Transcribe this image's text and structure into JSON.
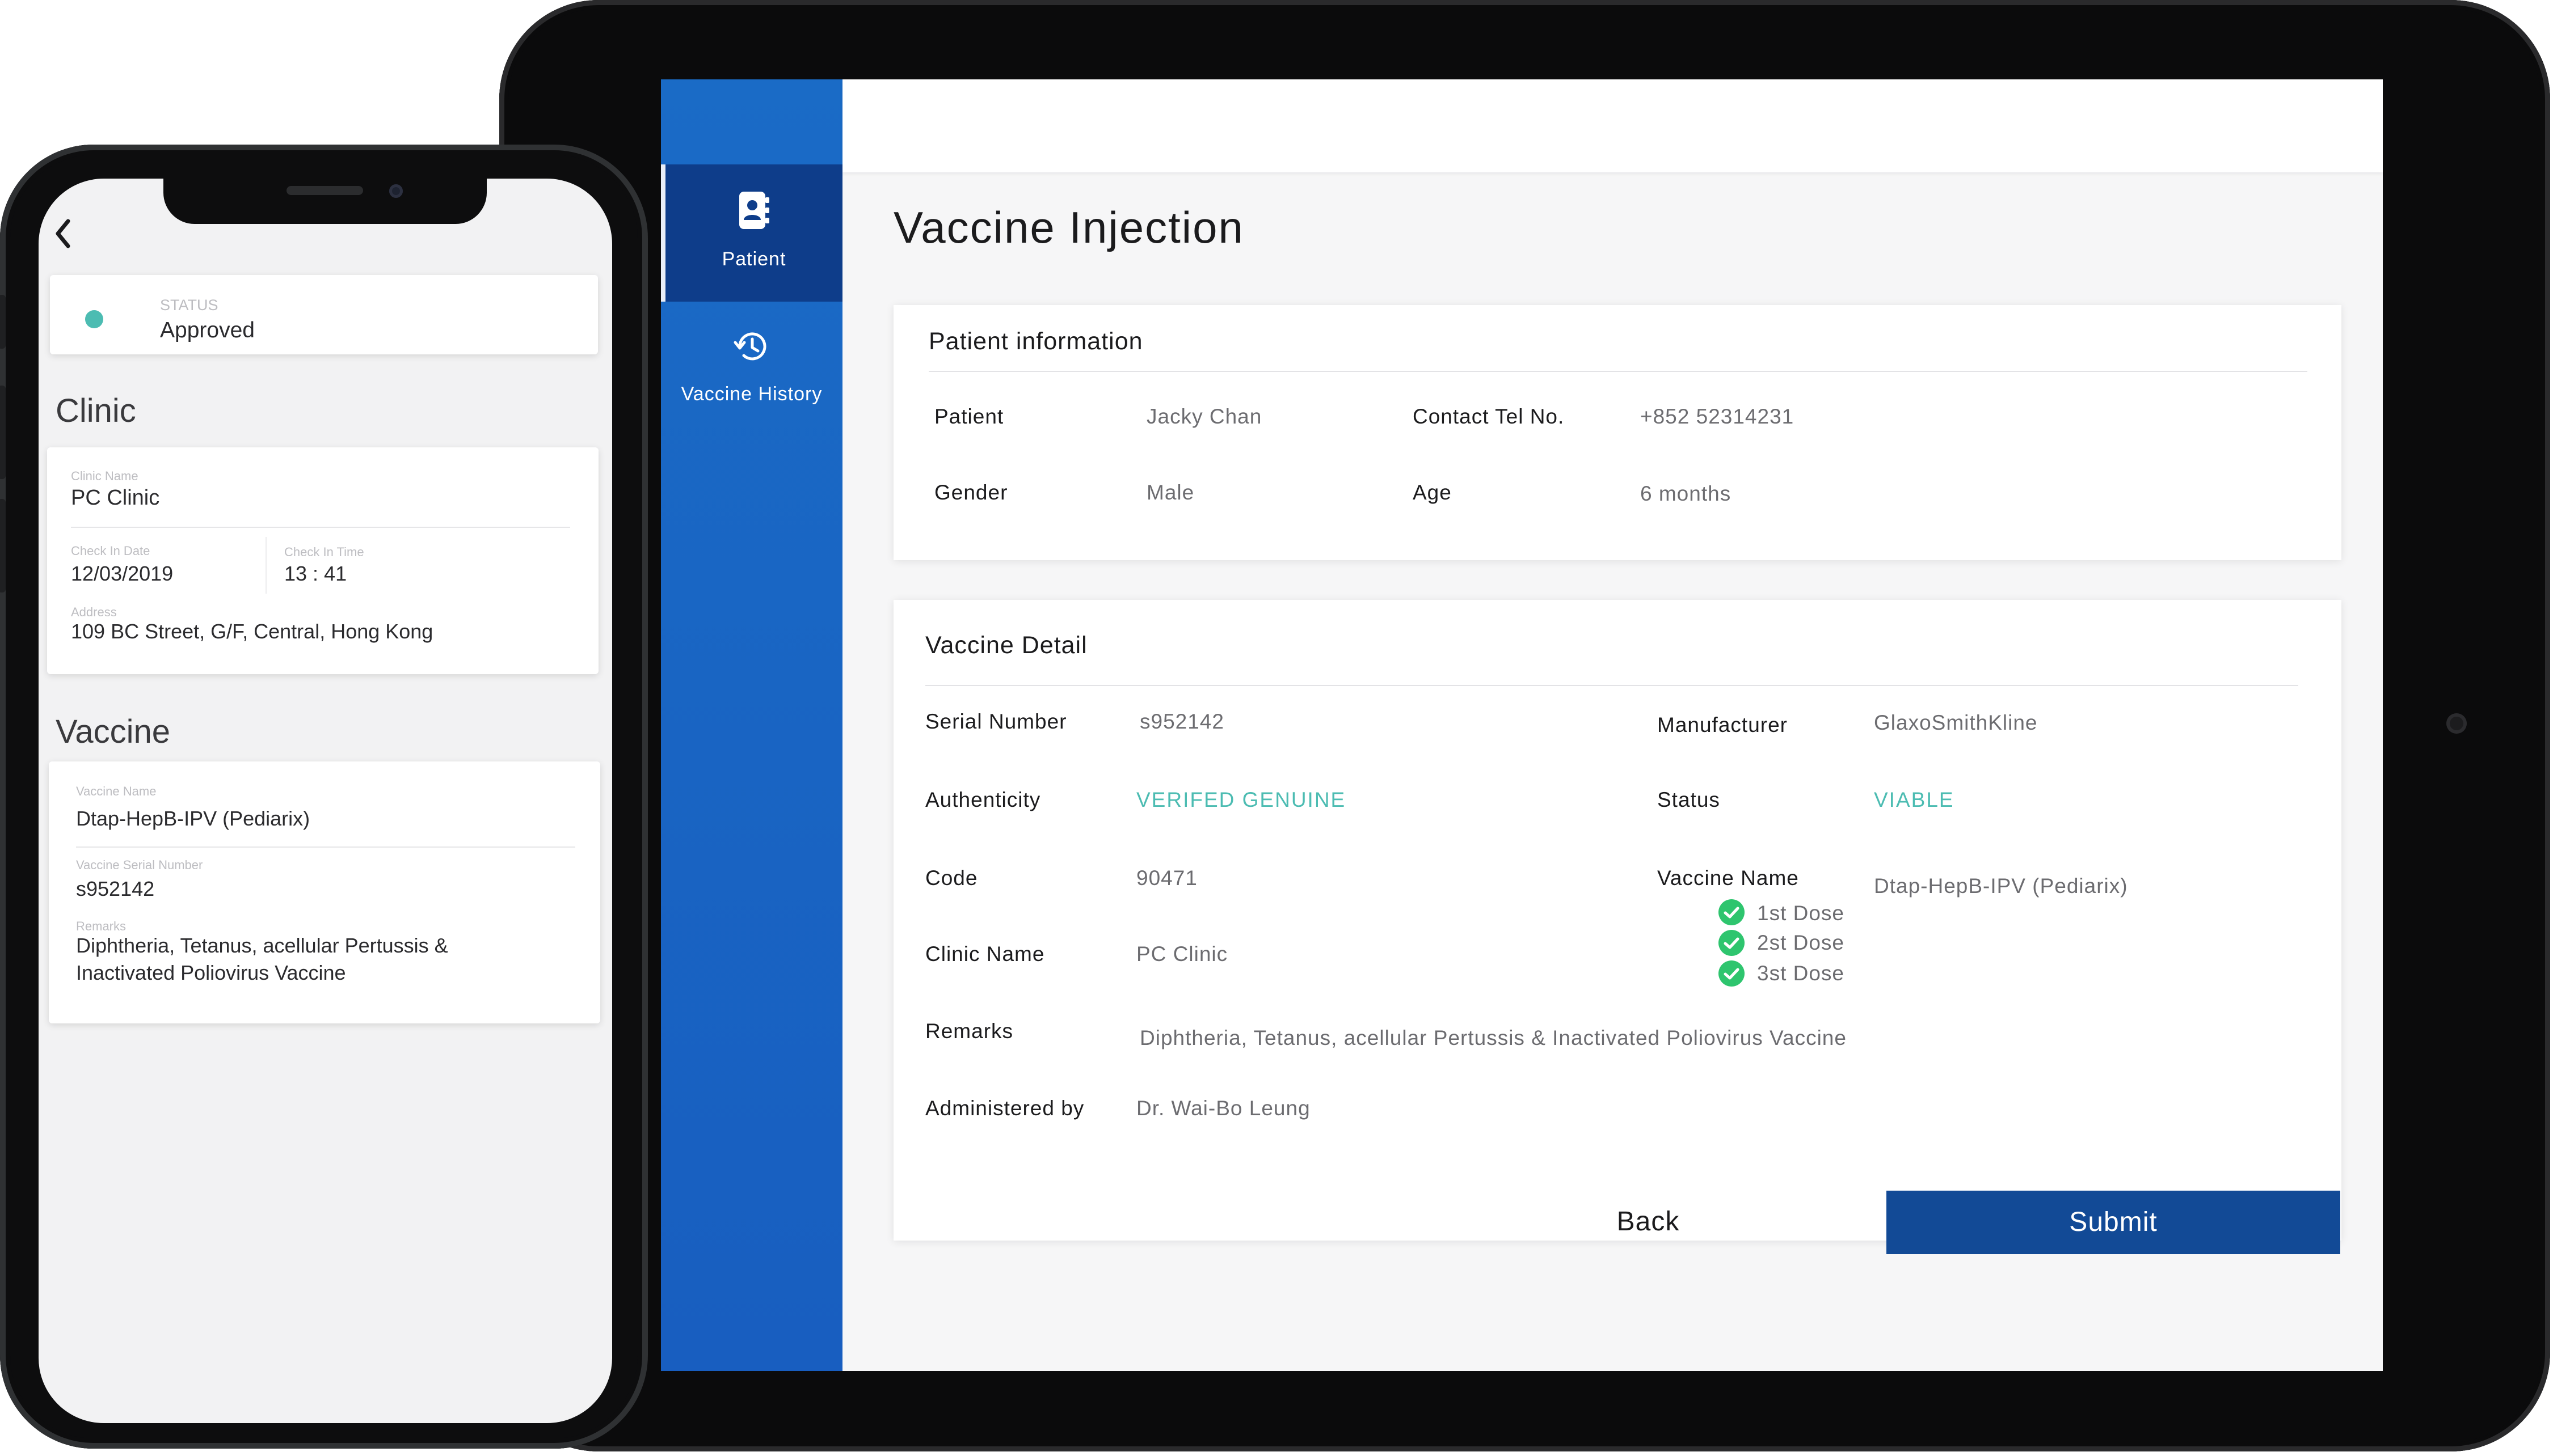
{
  "tablet": {
    "sidebar": {
      "items": [
        {
          "label": "Patient",
          "icon": "contact-book-icon",
          "active": true
        },
        {
          "label": "Vaccine History",
          "icon": "history-icon",
          "active": false
        }
      ]
    },
    "page_title": "Vaccine Injection",
    "patient_info": {
      "title": "Patient information",
      "patient_label": "Patient",
      "patient_value": "Jacky Chan",
      "tel_label": "Contact Tel No.",
      "tel_value": "+852 52314231",
      "gender_label": "Gender",
      "gender_value": "Male",
      "age_label": "Age",
      "age_value": "6 months"
    },
    "vaccine_detail": {
      "title": "Vaccine Detail",
      "serial_label": "Serial Number",
      "serial_value": "s952142",
      "manufacturer_label": "Manufacturer",
      "manufacturer_value": "GlaxoSmithKline",
      "authenticity_label": "Authenticity",
      "authenticity_value": "VERIFED GENUINE",
      "status_label": "Status",
      "status_value": "VIABLE",
      "code_label": "Code",
      "code_value": "90471",
      "vaccine_name_label": "Vaccine Name",
      "vaccine_name_value": "Dtap-HepB-IPV (Pediarix)",
      "clinic_label": "Clinic Name",
      "clinic_value": "PC Clinic",
      "doses": [
        "1st Dose",
        "2st Dose",
        "3st Dose"
      ],
      "remarks_label": "Remarks",
      "remarks_value": "Diphtheria, Tetanus, acellular Pertussis & Inactivated Poliovirus Vaccine",
      "admin_label": "Administered by",
      "admin_value": "Dr. Wai-Bo Leung"
    },
    "buttons": {
      "back": "Back",
      "submit": "Submit"
    },
    "colors": {
      "sidebar": "#1a6bc6",
      "sidebar_active": "#0e3d8a",
      "submit": "#124a96",
      "teal": "#4cbcb2",
      "check": "#2ec56e"
    }
  },
  "phone": {
    "status": {
      "label": "STATUS",
      "value": "Approved",
      "dot_color": "#4cbcb2"
    },
    "clinic_section": "Clinic",
    "clinic": {
      "name_label": "Clinic Name",
      "name_value": "PC Clinic",
      "date_label": "Check In Date",
      "date_value": "12/03/2019",
      "time_label": "Check In Time",
      "time_value": "13 : 41",
      "address_label": "Address",
      "address_value": "109 BC Street, G/F, Central, Hong Kong"
    },
    "vaccine_section": "Vaccine",
    "vaccine": {
      "name_label": "Vaccine Name",
      "name_value": "Dtap-HepB-IPV (Pediarix)",
      "serial_label": "Vaccine Serial Number",
      "serial_value": "s952142",
      "remarks_label": "Remarks",
      "remarks_line1": "Diphtheria, Tetanus, acellular Pertussis &",
      "remarks_line2": "Inactivated Poliovirus Vaccine"
    }
  }
}
